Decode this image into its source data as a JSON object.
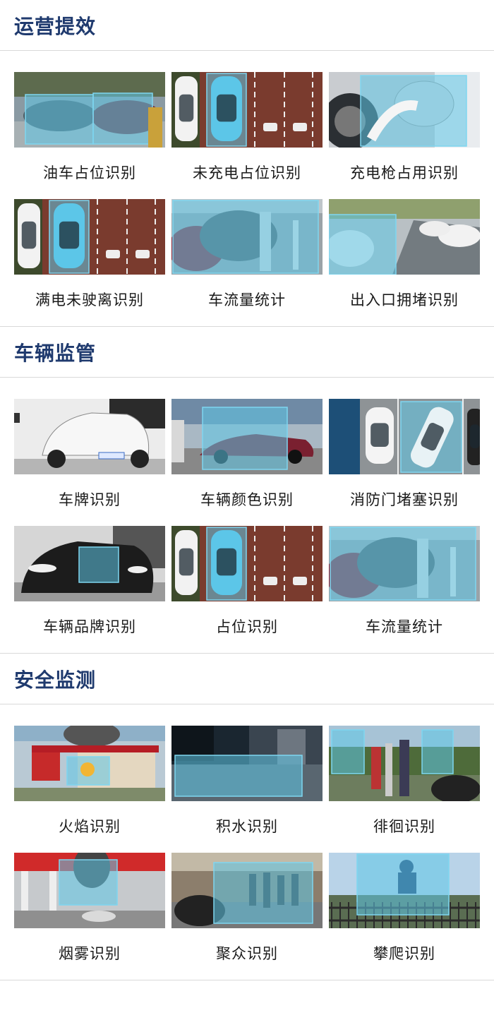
{
  "sections": [
    {
      "title": "运营提效",
      "items": [
        {
          "label": "油车占位识别",
          "scene": "parking-lot"
        },
        {
          "label": "未充电占位识别",
          "scene": "topdown-spots"
        },
        {
          "label": "充电枪占用识别",
          "scene": "charger-plug"
        },
        {
          "label": "满电未驶离识别",
          "scene": "topdown-spots"
        },
        {
          "label": "车流量统计",
          "scene": "charger-row"
        },
        {
          "label": "出入口拥堵识别",
          "scene": "road-queue"
        }
      ]
    },
    {
      "title": "车辆监管",
      "items": [
        {
          "label": "车牌识别",
          "scene": "white-suv"
        },
        {
          "label": "车辆颜色识别",
          "scene": "red-sedan"
        },
        {
          "label": "消防门堵塞识别",
          "scene": "topdown-door"
        },
        {
          "label": "车辆品牌识别",
          "scene": "car-front"
        },
        {
          "label": "占位识别",
          "scene": "topdown-spots"
        },
        {
          "label": "车流量统计",
          "scene": "charger-row"
        }
      ]
    },
    {
      "title": "安全监测",
      "items": [
        {
          "label": "火焰识别",
          "scene": "gas-station"
        },
        {
          "label": "积水识别",
          "scene": "flooded-street"
        },
        {
          "label": "徘徊识别",
          "scene": "people-park"
        },
        {
          "label": "烟雾识别",
          "scene": "smoke-station"
        },
        {
          "label": "聚众识别",
          "scene": "crowd"
        },
        {
          "label": "攀爬识别",
          "scene": "fence-climb"
        }
      ]
    }
  ],
  "colors": {
    "title": "#1f3a6e",
    "highlight": "#5fc6e6",
    "divider": "#d9d9d9"
  }
}
